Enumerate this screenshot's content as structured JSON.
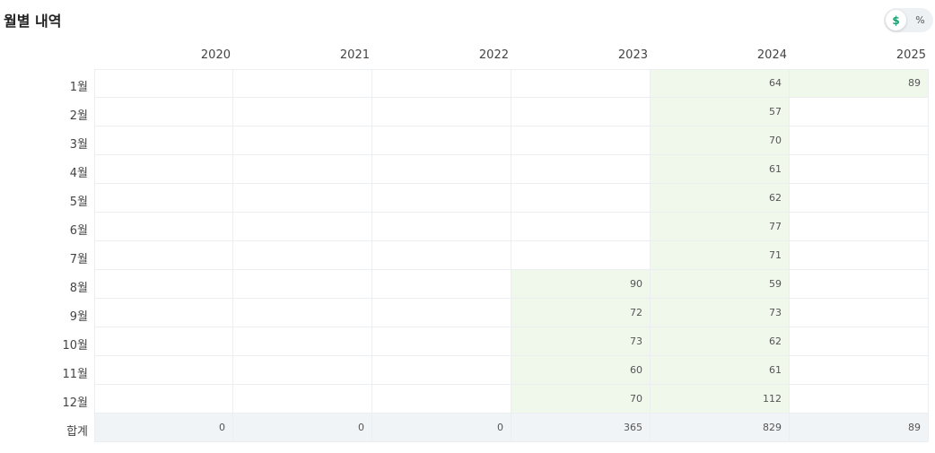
{
  "title": "월별 내역",
  "toggle": {
    "dollar": "$",
    "percent": "%",
    "selected": "$"
  },
  "years": [
    "2020",
    "2021",
    "2022",
    "2023",
    "2024",
    "2025"
  ],
  "months": [
    "1월",
    "2월",
    "3월",
    "4월",
    "5월",
    "6월",
    "7월",
    "8월",
    "9월",
    "10월",
    "11월",
    "12월"
  ],
  "total_label": "합계",
  "values": {
    "2020": [
      "",
      "",
      "",
      "",
      "",
      "",
      "",
      "",
      "",
      "",
      "",
      ""
    ],
    "2021": [
      "",
      "",
      "",
      "",
      "",
      "",
      "",
      "",
      "",
      "",
      "",
      ""
    ],
    "2022": [
      "",
      "",
      "",
      "",
      "",
      "",
      "",
      "",
      "",
      "",
      "",
      ""
    ],
    "2023": [
      "",
      "",
      "",
      "",
      "",
      "",
      "",
      "90",
      "72",
      "73",
      "60",
      "70"
    ],
    "2024": [
      "64",
      "57",
      "70",
      "61",
      "62",
      "77",
      "71",
      "59",
      "73",
      "62",
      "61",
      "112"
    ],
    "2025": [
      "89",
      "",
      "",
      "",
      "",
      "",
      "",
      "",
      "",
      "",
      "",
      ""
    ]
  },
  "totals": {
    "2020": "0",
    "2021": "0",
    "2022": "0",
    "2023": "365",
    "2024": "829",
    "2025": "89"
  },
  "colors": {
    "filled": "#f0f8ec",
    "total_row": "#f1f4f7",
    "toggle_active": "#1a9e6d"
  }
}
